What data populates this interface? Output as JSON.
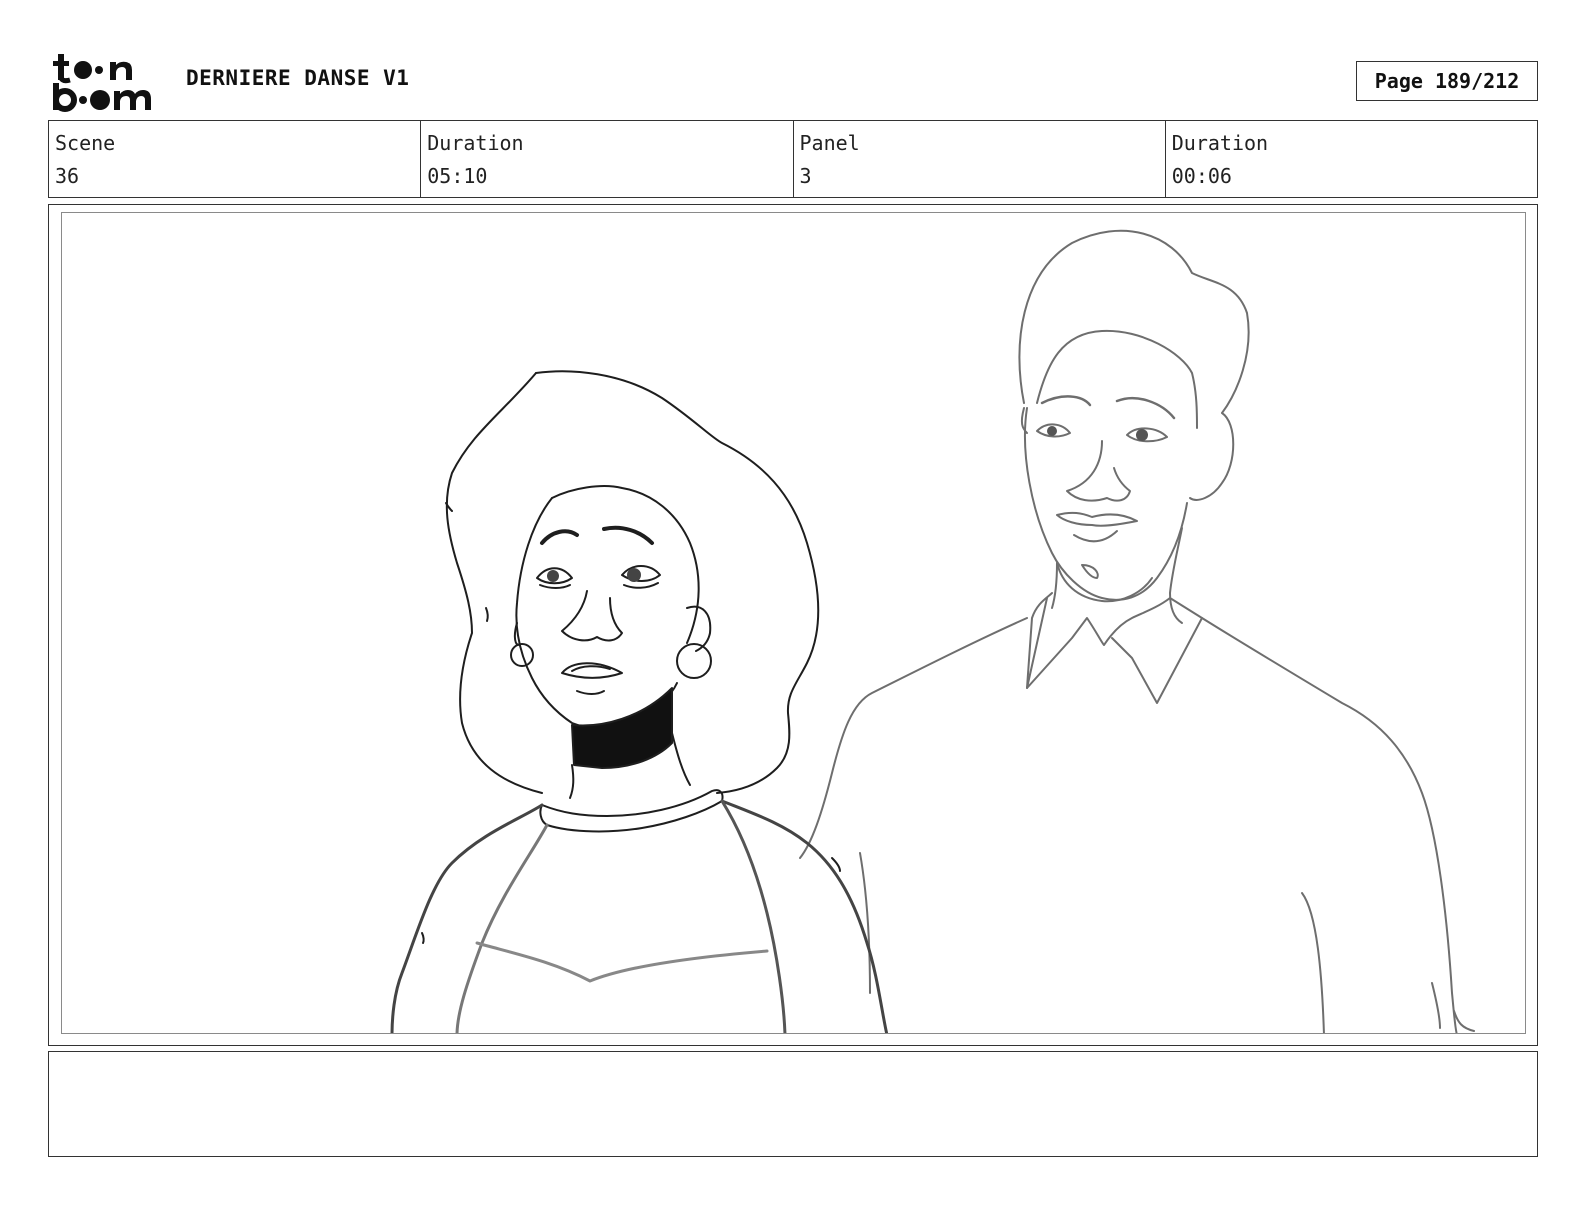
{
  "header": {
    "logo": {
      "name": "toonboom-logo",
      "line1": "toon",
      "line2": "boom"
    },
    "project_title": "DERNIERE DANSE V1",
    "page_label": "Page 189/212"
  },
  "info": {
    "scene_label": "Scene",
    "scene_value": "36",
    "scene_duration_label": "Duration",
    "scene_duration_value": "05:10",
    "panel_label": "Panel",
    "panel_value": "3",
    "panel_duration_label": "Duration",
    "panel_duration_value": "00:06"
  },
  "panel": {
    "drawing": "storyboard-sketch"
  },
  "notes": {
    "text": ""
  }
}
